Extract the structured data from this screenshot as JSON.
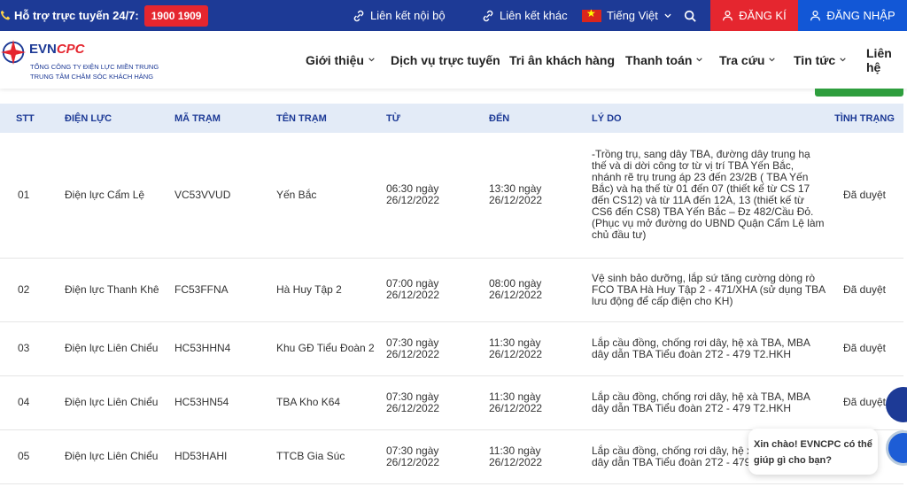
{
  "topbar": {
    "hotline_label": "Hỗ trợ trực tuyến 24/7:",
    "hotline_number": "1900 1909",
    "links": [
      "Liên kết nội bộ",
      "Liên kết khác"
    ],
    "language": "Tiếng Việt",
    "register": "ĐĂNG KÍ",
    "login": "ĐĂNG NHẬP"
  },
  "logo": {
    "brand_main": "EVN",
    "brand_accent": "CPC",
    "line1": "TỔNG CÔNG TY ĐIỆN LỰC MIỀN TRUNG",
    "line2": "TRUNG TÂM CHĂM SÓC KHÁCH HÀNG"
  },
  "nav": [
    "Giới thiệu",
    "Dịch vụ trực tuyến",
    "Tri ân khách hàng",
    "Thanh toán",
    "Tra cứu",
    "Tin tức",
    "Liên hệ"
  ],
  "table": {
    "headers": [
      "STT",
      "ĐIỆN LỰC",
      "MÃ TRẠM",
      "TÊN TRẠM",
      "TỪ",
      "ĐẾN",
      "LÝ DO",
      "TÌNH TRẠNG"
    ],
    "rows": [
      [
        "01",
        "Điện lực Cẩm Lệ",
        "VC53VVUD",
        "Yến Bắc",
        "06:30 ngày 26/12/2022",
        "13:30 ngày 26/12/2022",
        "-Trồng trụ, sang dây TBA, đường dây trung hạ thế và di dời công tơ từ vị trí TBA Yến Bắc, nhánh rẽ trụ trung áp 23 đến 23/2B ( TBA Yến Bắc) và hạ thế từ 01 đến 07 (thiết kế từ CS 17 đến CS12) và từ 11A đến 12A, 13 (thiết kế từ CS6 đến CS8) TBA Yến Bắc – Đz 482/Cầu Đỏ. (Phục vụ mở đường do UBND Quận Cẩm Lệ làm chủ đầu tư)",
        "Đã duyệt"
      ],
      [
        "02",
        "Điện lực Thanh Khê",
        "FC53FFNA",
        "Hà Huy Tập 2",
        "07:00 ngày 26/12/2022",
        "08:00 ngày 26/12/2022",
        "Vệ sinh bảo dưỡng, lắp sứ tăng cường dòng rò FCO TBA Hà Huy Tập 2 - 471/XHA (sử dụng TBA lưu động để cấp điện cho KH)",
        "Đã duyệt"
      ],
      [
        "03",
        "Điện lực Liên Chiểu",
        "HC53HHN4",
        "Khu GĐ Tiểu Đoàn 2",
        "07:30 ngày 26/12/2022",
        "11:30 ngày 26/12/2022",
        "Lắp cầu đồng, chống rơi dây, hệ xà TBA, MBA dây dẫn TBA Tiểu đoàn 2T2 - 479 T2.HKH",
        "Đã duyệt"
      ],
      [
        "04",
        "Điện lực Liên Chiểu",
        "HC53HN54",
        "TBA Kho K64",
        "07:30 ngày 26/12/2022",
        "11:30 ngày 26/12/2022",
        "Lắp cầu đồng, chống rơi dây, hệ xà TBA, MBA dây dẫn TBA Tiểu đoàn 2T2 - 479 T2.HKH",
        "Đã duyệt"
      ],
      [
        "05",
        "Điện lực Liên Chiểu",
        "HD53HAHI",
        "TTCB Gia Súc",
        "07:30 ngày 26/12/2022",
        "11:30 ngày 26/12/2022",
        "Lắp cầu đồng, chống rơi dây, hệ xà TBA, MBA dây dẫn TBA Tiểu đoàn 2T2 - 479 T2.HKH",
        ""
      ]
    ]
  },
  "chat": {
    "greeting": "Xin chào! EVNCPC có thể giúp gì cho bạn?"
  },
  "colors": {
    "primary": "#1d3a96",
    "accent_red": "#e5262f",
    "header_row": "#e3ebf7",
    "green": "#2e9e3e"
  }
}
